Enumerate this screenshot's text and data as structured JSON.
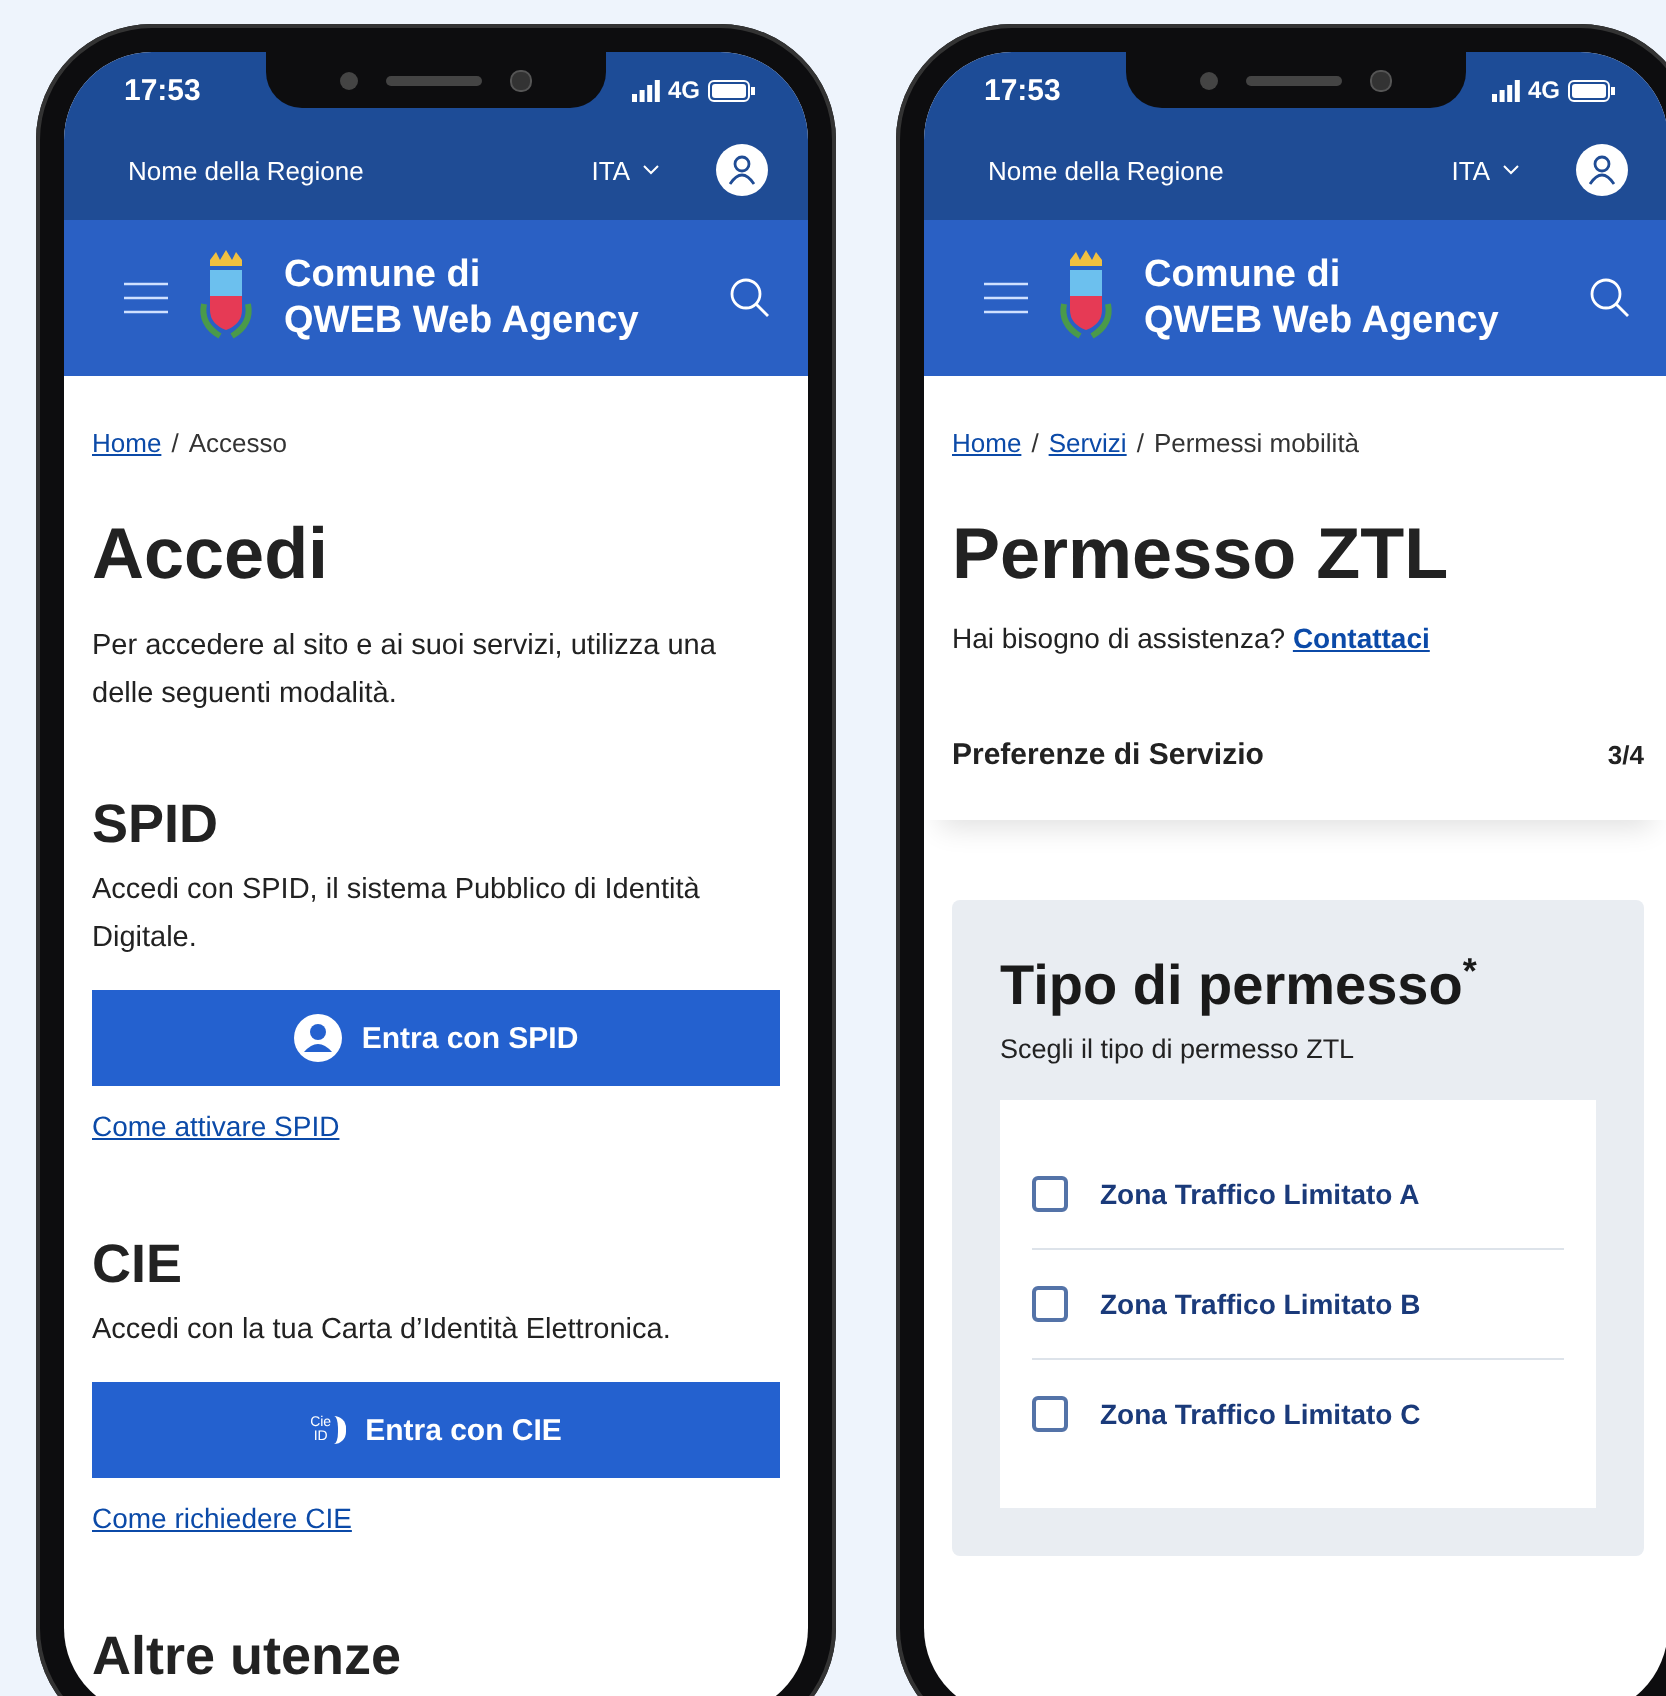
{
  "phones": [
    {
      "status_bar": {
        "time": "17:53",
        "network": "4G"
      },
      "top_bar": {
        "region": "Nome della Regione",
        "language": "ITA"
      },
      "header": {
        "title_lines": [
          "Comune di",
          "QWEB Web Agency"
        ]
      },
      "blocks": [
        {
          "kind": "breadcrumb",
          "separator": "/",
          "items": [
            {
              "label": "Home",
              "link": true
            },
            {
              "label": "Accesso",
              "link": false
            }
          ]
        },
        {
          "kind": "heading",
          "text": "Accedi"
        },
        {
          "kind": "paragraph",
          "text": "Per accedere al sito e ai suoi servizi, utilizza una delle seguenti modalità."
        },
        {
          "kind": "subheading",
          "text": "SPID"
        },
        {
          "kind": "paragraph",
          "text": "Accedi con SPID, il sistema Pubblico di Identità Digitale."
        },
        {
          "kind": "button",
          "label": "Entra con SPID"
        },
        {
          "kind": "link",
          "text": "Come attivare SPID"
        },
        {
          "kind": "subheading",
          "text": "CIE"
        },
        {
          "kind": "paragraph",
          "text": "Accedi con la tua Carta d’Identità Elettronica."
        },
        {
          "kind": "button",
          "logo_text": [
            "Cie",
            "ID"
          ],
          "label": "Entra con CIE"
        },
        {
          "kind": "link",
          "text": "Come richiedere CIE"
        },
        {
          "kind": "subheading",
          "text": "Altre utenze"
        }
      ]
    },
    {
      "status_bar": {
        "time": "17:53",
        "network": "4G"
      },
      "top_bar": {
        "region": "Nome della Regione",
        "language": "ITA"
      },
      "header": {
        "title_lines": [
          "Comune di",
          "QWEB Web Agency"
        ]
      },
      "blocks": [
        {
          "kind": "breadcrumb",
          "separator": "/",
          "items": [
            {
              "label": "Home",
              "link": true
            },
            {
              "label": "Servizi",
              "link": true
            },
            {
              "label": "Permessi mobilità",
              "link": false
            }
          ]
        },
        {
          "kind": "heading",
          "text": "Permesso ZTL"
        },
        {
          "kind": "help",
          "text": "Hai bisogno di assistenza?",
          "link": "Contattaci"
        },
        {
          "kind": "step",
          "label": "Preferenze di Servizio",
          "count": "3/4"
        },
        {
          "kind": "fieldset",
          "title": "Tipo di permesso$^{*}$",
          "subtitle": "Scegli il tipo di permesso ZTL",
          "options": [
            {
              "label": "Zona Traffico Limitato A",
              "checked": false
            },
            {
              "label": "Zona Traffico Limitato B",
              "checked": false
            },
            {
              "label": "Zona Traffico Limitato C",
              "checked": false
            }
          ]
        }
      ]
    }
  ]
}
